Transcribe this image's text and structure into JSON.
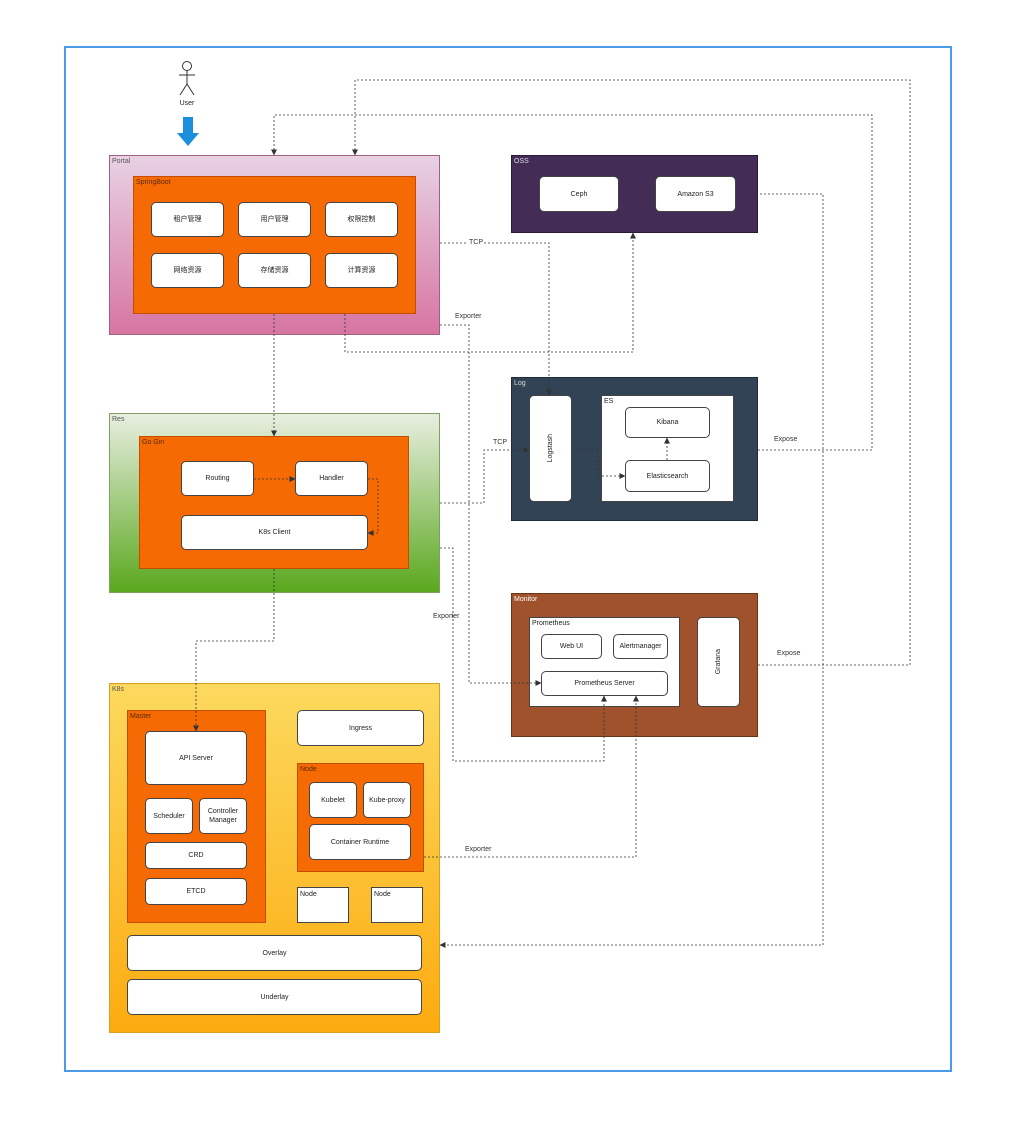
{
  "user": {
    "label": "User"
  },
  "portal": {
    "label": "Portal",
    "springboot": {
      "label": "SpringBoot",
      "items": [
        "租户管理",
        "用户管理",
        "权限控制",
        "网络资源",
        "存储资源",
        "计算资源"
      ]
    }
  },
  "res": {
    "label": "Res",
    "gogin": {
      "label": "Go Gin",
      "routing": "Routing",
      "handler": "Handler",
      "k8s_client": "K8s Client"
    }
  },
  "k8s": {
    "label": "K8s",
    "master": {
      "label": "Master",
      "api_server": "API Server",
      "scheduler": "Scheduler",
      "controller_manager": "Controller Manager",
      "crd": "CRD",
      "etcd": "ETCD"
    },
    "ingress": "Ingress",
    "node": {
      "label": "Node",
      "kubelet": "Kubelet",
      "kube_proxy": "Kube-proxy",
      "container_runtime": "Container Runtime"
    },
    "node2": "Node",
    "node3": "Node",
    "overlay": "Overlay",
    "underlay": "Underlay"
  },
  "oss": {
    "label": "OSS",
    "ceph": "Ceph",
    "s3": "Amazon S3"
  },
  "log": {
    "label": "Log",
    "logstash": "Logstash",
    "es": {
      "label": "ES",
      "kibana": "Kibana",
      "elasticsearch": "Elasticsearch"
    }
  },
  "monitor": {
    "label": "Monitor",
    "prometheus": {
      "label": "Prometheus",
      "webui": "Web UI",
      "alertmanager": "Alertmanager",
      "server": "Prometheus Server"
    },
    "grafana": "Grafana"
  },
  "edges": {
    "tcp1": "TCP",
    "tcp2": "TCP",
    "exporter1": "Exporter",
    "exporter2": "Exporter",
    "exporter3": "Exporter",
    "expose1": "Expose",
    "expose2": "Expose"
  },
  "colors": {
    "frame": "#4a9be8",
    "orange": "#f66a03",
    "oss": "#432d57",
    "log": "#314354",
    "monitor": "#a0522d",
    "arrow_user": "#1b8fdc"
  }
}
